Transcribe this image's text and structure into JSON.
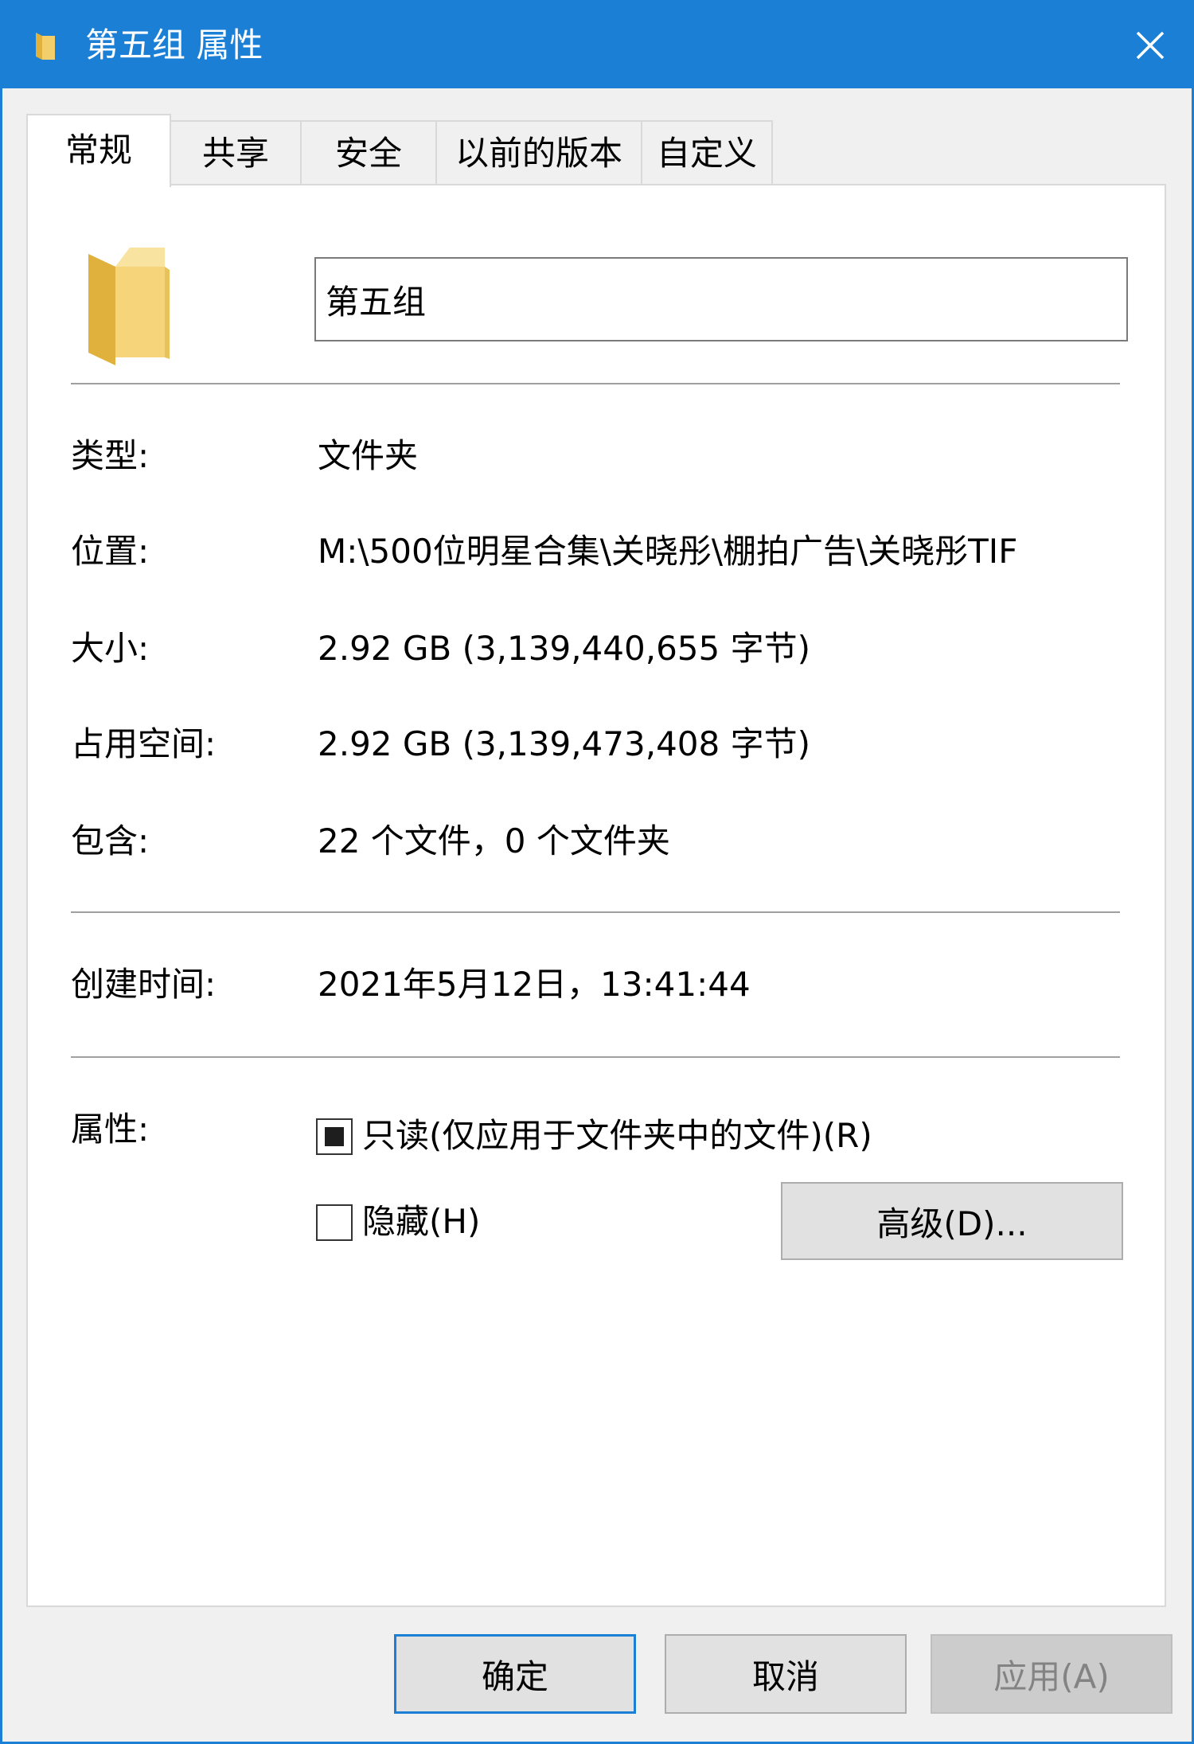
{
  "window": {
    "title": "第五组 属性"
  },
  "tabs": [
    {
      "label": "常规",
      "active": true
    },
    {
      "label": "共享",
      "active": false
    },
    {
      "label": "安全",
      "active": false
    },
    {
      "label": "以前的版本",
      "active": false
    },
    {
      "label": "自定义",
      "active": false
    }
  ],
  "general": {
    "folder_name": "第五组",
    "type_label": "类型:",
    "type_value": "文件夹",
    "location_label": "位置:",
    "location_value": "M:\\500位明星合集\\关晓彤\\棚拍广告\\关晓彤TIF",
    "size_label": "大小:",
    "size_value": "2.92 GB (3,139,440,655 字节)",
    "disk_size_label": "占用空间:",
    "disk_size_value": "2.92 GB (3,139,473,408 字节)",
    "contains_label": "包含:",
    "contains_value": "22 个文件，0 个文件夹",
    "created_label": "创建时间:",
    "created_value": "2021年5月12日，13:41:44",
    "attributes_label": "属性:",
    "readonly_label": "只读(仅应用于文件夹中的文件)(R)",
    "readonly_state": "indeterminate",
    "hidden_label": "隐藏(H)",
    "hidden_checked": false,
    "advanced_button": "高级(D)..."
  },
  "footer": {
    "ok": "确定",
    "cancel": "取消",
    "apply": "应用(A)"
  },
  "colors": {
    "titlebar": "#1c7fd6",
    "folder_yellow": "#f3cf6b",
    "folder_dark": "#e0b23d"
  }
}
